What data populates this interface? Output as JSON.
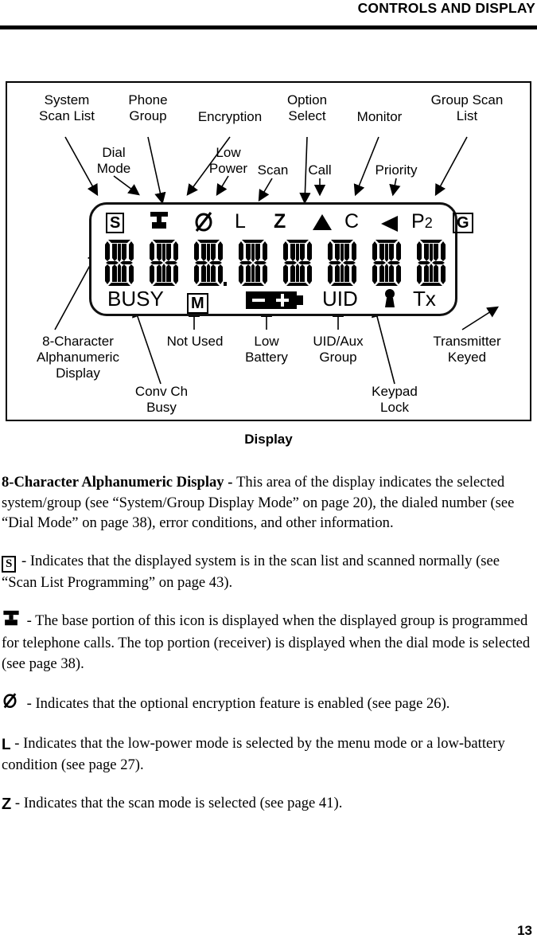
{
  "header": {
    "title": "CONTROLS AND DISPLAY"
  },
  "figure": {
    "caption": "Display",
    "callouts_top": [
      {
        "id": "system-scan-list",
        "label": "System\nScan List"
      },
      {
        "id": "dial-mode",
        "label": "Dial\nMode"
      },
      {
        "id": "phone-group",
        "label": "Phone\nGroup"
      },
      {
        "id": "encryption",
        "label": "Encryption"
      },
      {
        "id": "low-power",
        "label": "Low\nPower"
      },
      {
        "id": "scan",
        "label": "Scan"
      },
      {
        "id": "option-select",
        "label": "Option\nSelect"
      },
      {
        "id": "call",
        "label": "Call"
      },
      {
        "id": "monitor",
        "label": "Monitor"
      },
      {
        "id": "priority",
        "label": "Priority"
      },
      {
        "id": "group-scan-list",
        "label": "Group Scan\nList"
      }
    ],
    "callouts_bottom": [
      {
        "id": "alphanumeric-display",
        "label": "8-Character\nAlphanumeric\nDisplay"
      },
      {
        "id": "conv-ch-busy",
        "label": "Conv Ch\nBusy"
      },
      {
        "id": "not-used",
        "label": "Not Used"
      },
      {
        "id": "low-battery",
        "label": "Low\nBattery"
      },
      {
        "id": "uid-aux-group",
        "label": "UID/Aux\nGroup"
      },
      {
        "id": "keypad-lock",
        "label": "Keypad\nLock"
      },
      {
        "id": "transmitter-keyed",
        "label": "Transmitter\nKeyed"
      }
    ],
    "lcd": {
      "annunciators_top": [
        {
          "id": "scan-list-s",
          "glyph": "S",
          "style": "boxed"
        },
        {
          "id": "phone",
          "glyph": "phone-icon",
          "style": "icon"
        },
        {
          "id": "encryption",
          "glyph": "encryption-icon",
          "style": "icon"
        },
        {
          "id": "low-power",
          "glyph": "L",
          "style": "plain"
        },
        {
          "id": "scan",
          "glyph": "Z",
          "style": "plain"
        },
        {
          "id": "option-select",
          "glyph": "triangle-up-icon",
          "style": "icon"
        },
        {
          "id": "call",
          "glyph": "C",
          "style": "plain"
        },
        {
          "id": "monitor",
          "glyph": "triangle-left-icon",
          "style": "icon"
        },
        {
          "id": "priority",
          "glyph": "P2",
          "style": "plain"
        },
        {
          "id": "group-scan-list-g",
          "glyph": "G",
          "style": "boxed"
        }
      ],
      "character_count": 8,
      "annunciators_bottom": [
        {
          "id": "busy",
          "glyph": "BUSY",
          "style": "plain"
        },
        {
          "id": "not-used-m",
          "glyph": "M",
          "style": "boxed"
        },
        {
          "id": "low-battery",
          "glyph": "battery-icon",
          "style": "icon"
        },
        {
          "id": "uid",
          "glyph": "UID",
          "style": "plain"
        },
        {
          "id": "keypad-lock",
          "glyph": "lock-icon",
          "style": "icon"
        },
        {
          "id": "transmitter-keyed",
          "glyph": "Tx",
          "style": "plain"
        }
      ]
    }
  },
  "body": {
    "p1": {
      "bold": "8-Character Alphanumeric Display - ",
      "text": "This area of the display indicates the selected system/group (see “System/Group Display Mode” on page 20), the dialed number (see “Dial Mode” on page 38), error conditions, and other information."
    },
    "p2": {
      "icon": "S",
      "text": " - Indicates that the displayed system is in the scan list and scanned normally (see “Scan List Programming” on page 43)."
    },
    "p3": {
      "icon": "phone-icon",
      "text": " - The base portion of this icon is displayed when the displayed group is programmed for telephone calls. The top portion (receiver) is displayed when the dial mode is selected (see page 38)."
    },
    "p4": {
      "icon": "encryption-icon",
      "text": " - Indicates that the optional encryption feature is enabled (see page 26)."
    },
    "p5": {
      "icon": "L",
      "text": " - Indicates that the low-power mode is selected by the menu mode or a low-battery condition (see page 27)."
    },
    "p6": {
      "icon": "Z",
      "text": " - Indicates that the scan mode is selected (see page 41)."
    }
  },
  "footer": {
    "page_number": "13"
  }
}
